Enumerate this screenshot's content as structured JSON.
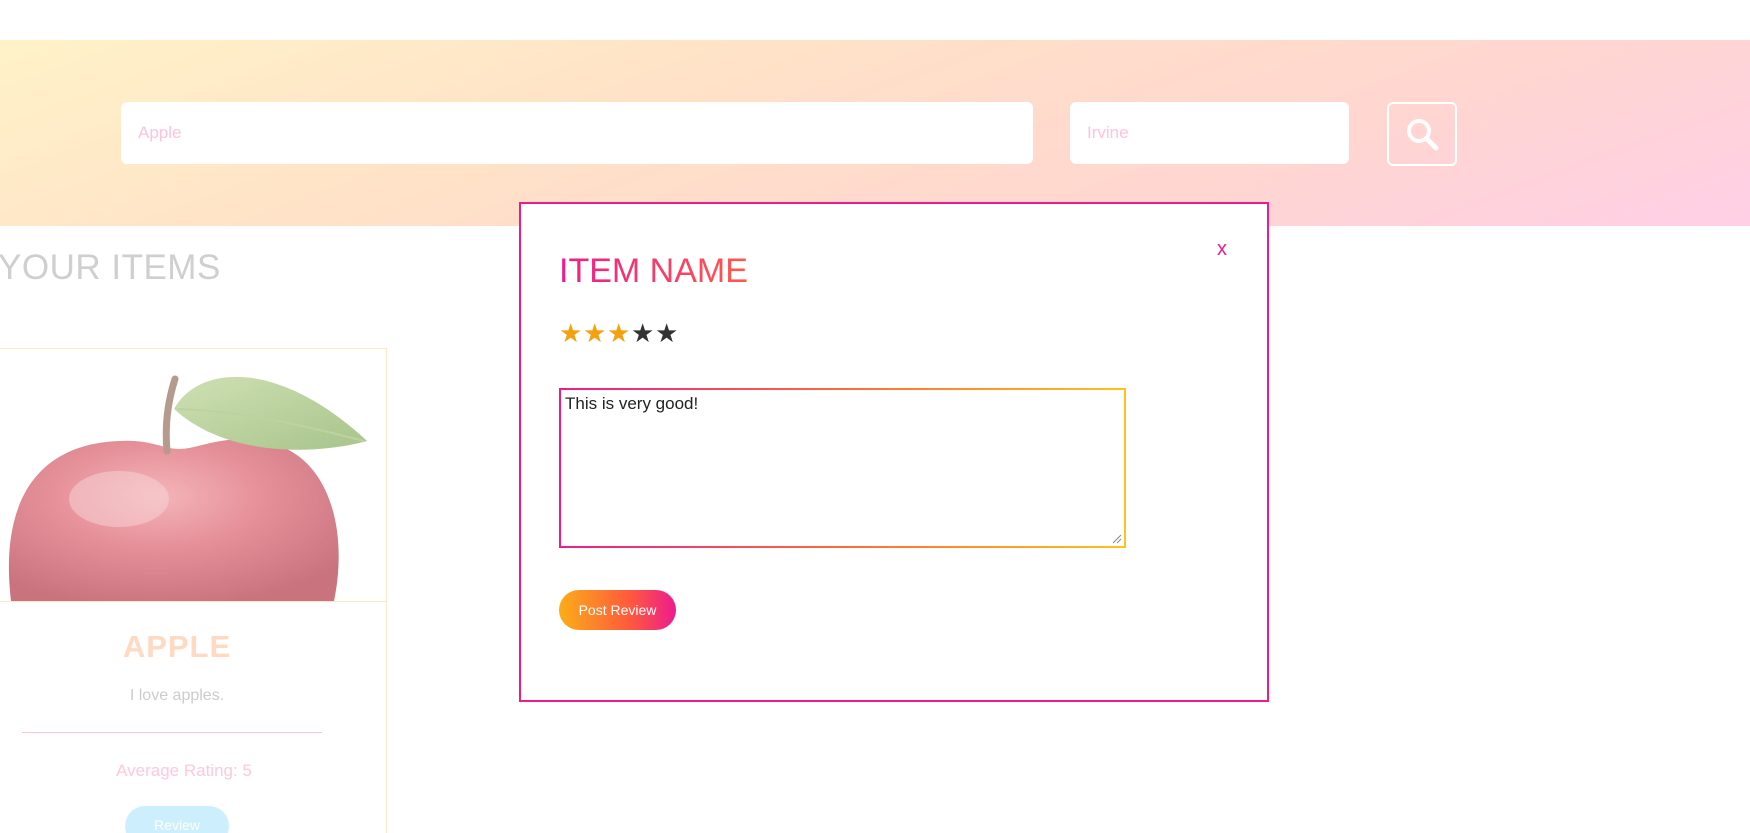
{
  "search": {
    "what_value": "Apple",
    "where_value": "Irvine",
    "button_icon": "search-icon"
  },
  "page": {
    "heading": "YOUR ITEMS"
  },
  "item_card": {
    "name": "APPLE",
    "description": "I love apples.",
    "average_rating_text": "Average Rating: 5",
    "review_button_label": "Review"
  },
  "modal": {
    "close_label": "x",
    "title": "ITEM NAME",
    "rating": {
      "filled": 3,
      "max": 5
    },
    "review_text": "This is very good!",
    "post_button_label": "Post Review"
  },
  "colors": {
    "accent": "#ec1c8e",
    "star_filled": "#f5a10d",
    "star_empty": "#333333"
  }
}
